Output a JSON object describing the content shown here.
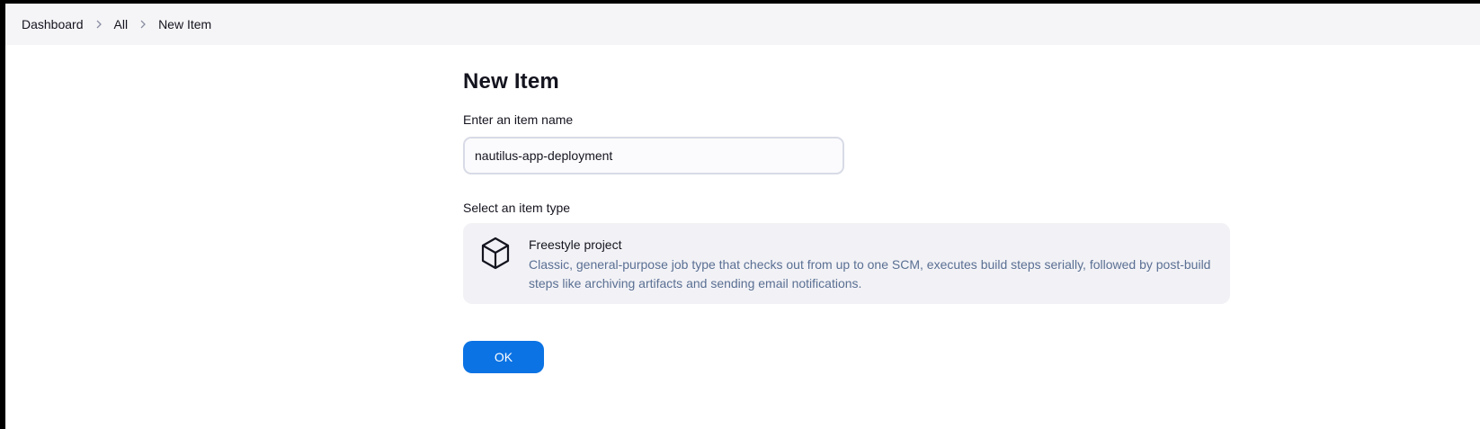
{
  "breadcrumb": {
    "items": [
      {
        "label": "Dashboard"
      },
      {
        "label": "All"
      },
      {
        "label": "New Item"
      }
    ],
    "separator_icon": "chevron-right-icon"
  },
  "main": {
    "title": "New Item",
    "name_field": {
      "label": "Enter an item name",
      "value": "nautilus-app-deployment"
    },
    "item_type": {
      "section_label": "Select an item type",
      "options": [
        {
          "icon": "cube-icon",
          "title": "Freestyle project",
          "description": "Classic, general-purpose job type that checks out from up to one SCM, executes build steps serially, followed by post-build steps like archiving artifacts and sending email notifications."
        }
      ]
    },
    "ok_label": "OK"
  },
  "colors": {
    "accent": "#0b73e4",
    "topbar_bg": "#f5f5f7",
    "card_bg": "#f2f2f6",
    "description_text": "#5a6f93"
  }
}
